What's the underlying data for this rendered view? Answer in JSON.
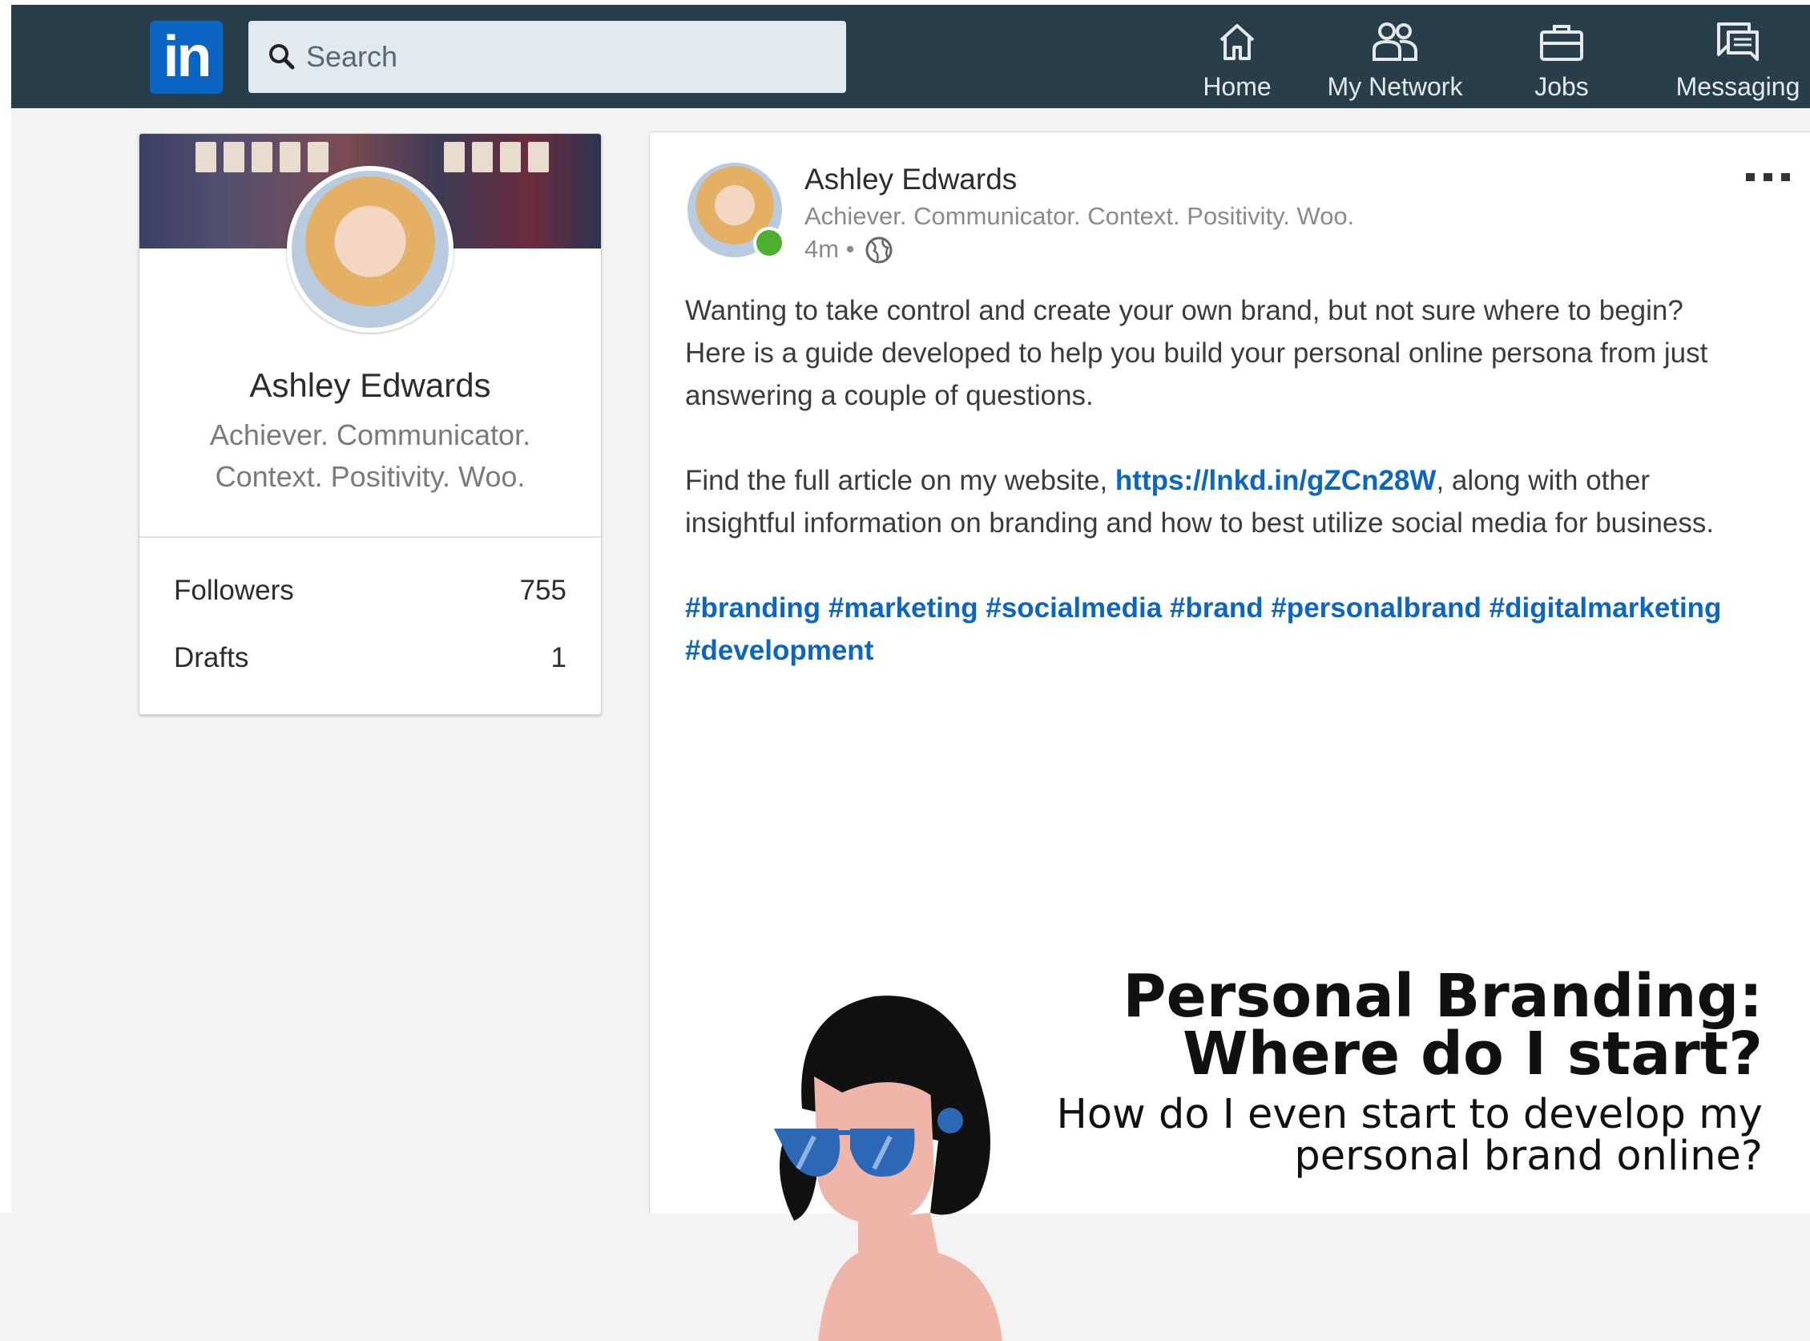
{
  "nav": {
    "logo_text": "in",
    "search_placeholder": "Search",
    "items": [
      {
        "label": "Home",
        "icon": "home-icon"
      },
      {
        "label": "My Network",
        "icon": "network-icon"
      },
      {
        "label": "Jobs",
        "icon": "briefcase-icon"
      },
      {
        "label": "Messaging",
        "icon": "messaging-icon"
      }
    ]
  },
  "profile_card": {
    "name": "Ashley Edwards",
    "headline": "Achiever. Communicator. Context. Positivity. Woo.",
    "stats": [
      {
        "label": "Followers",
        "value": "755"
      },
      {
        "label": "Drafts",
        "value": "1"
      }
    ]
  },
  "post": {
    "author": "Ashley Edwards",
    "headline": "Achiever. Communicator. Context. Positivity. Woo.",
    "time": "4m •",
    "para1": [
      "Wanting to take control and create your own brand, but not sure where to begin?",
      "Here is a guide developed to help you build your personal online persona from just",
      "answering a couple of questions."
    ],
    "para2_before_link": "Find the full article on my website, ",
    "link": "https://lnkd.in/gZCn28W",
    "para2_after_link": ", along with other",
    "para2_line2": "insightful information on branding and how to best utilize social media for business.",
    "hashtags_line1": "#branding #marketing #socialmedia #brand #personalbrand #digitalmarketing",
    "hashtags_line2": "#development",
    "image": {
      "title_line1": "Personal Branding:",
      "title_line2": "Where do I start?",
      "subtitle_line1": "How do I even start to develop my",
      "subtitle_line2": "personal brand online?"
    }
  },
  "colors": {
    "navbar": "#283e4a",
    "brand_blue": "#0a66c2",
    "presence_green": "#4caf2e"
  }
}
